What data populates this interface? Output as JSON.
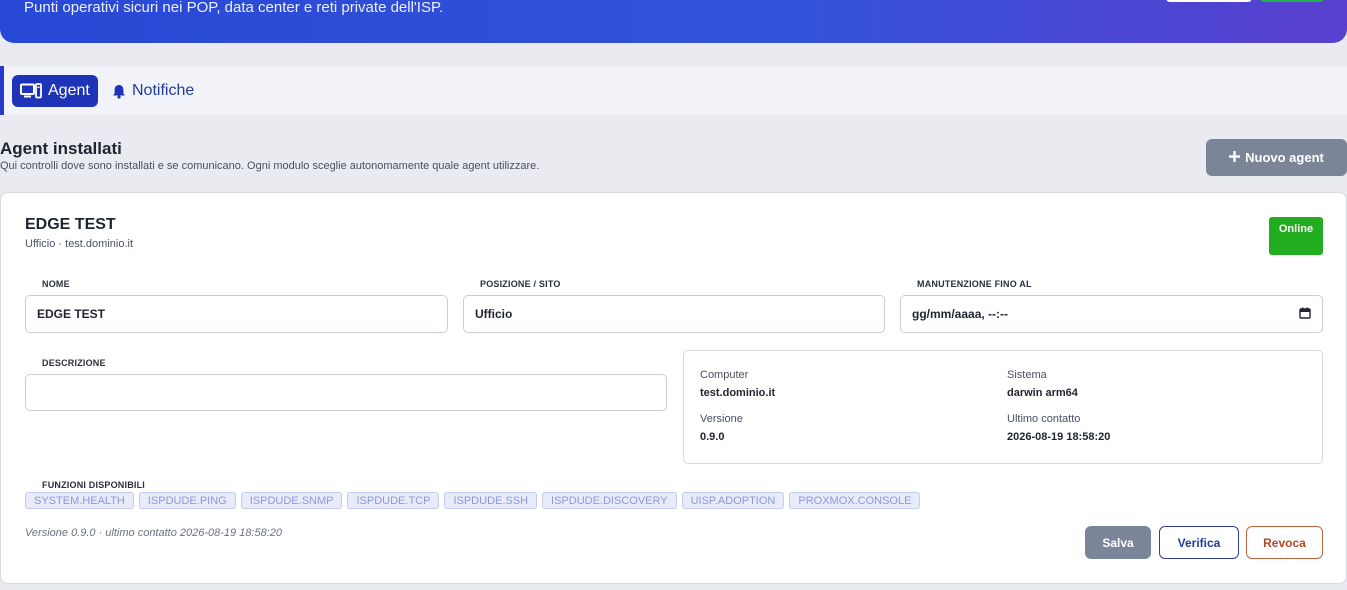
{
  "hero": {
    "subtitle": "Punti operativi sicuri nei POP, data center e reti private dell'ISP."
  },
  "tabs": [
    {
      "label": "Agent",
      "icon": "monitor-icon",
      "active": true
    },
    {
      "label": "Notifiche",
      "icon": "bell-icon",
      "active": false
    }
  ],
  "section": {
    "title": "Agent installati",
    "description": "Qui controlli dove sono installati e se comunicano. Ogni modulo sceglie autonomamente quale agent utilizzare.",
    "new_button": "Nuovo agent"
  },
  "agent": {
    "title": "EDGE TEST",
    "subtitle": "Ufficio · test.dominio.it",
    "status": "Online",
    "fields": {
      "nome_label": "NOME",
      "nome_value": "EDGE TEST",
      "posizione_label": "POSIZIONE / SITO",
      "posizione_value": "Ufficio",
      "manutenzione_label": "MANUTENZIONE FINO AL",
      "manutenzione_placeholder": "gg/mm/aaaa, --:--",
      "descrizione_label": "DESCRIZIONE",
      "descrizione_value": ""
    },
    "info": {
      "computer_label": "Computer",
      "computer_value": "test.dominio.it",
      "sistema_label": "Sistema",
      "sistema_value": "darwin arm64",
      "versione_label": "Versione",
      "versione_value": "0.9.0",
      "contatto_label": "Ultimo contatto",
      "contatto_value": "2026-08-19 18:58:20"
    },
    "functions_label": "FUNZIONI DISPONIBILI",
    "functions": [
      "SYSTEM.HEALTH",
      "ISPDUDE.PING",
      "ISPDUDE.SNMP",
      "ISPDUDE.TCP",
      "ISPDUDE.SSH",
      "ISPDUDE.DISCOVERY",
      "UISP.ADOPTION",
      "PROXMOX.CONSOLE"
    ],
    "footer": "Versione 0.9.0 · ultimo contatto 2026-08-19 18:58:20",
    "buttons": {
      "salva": "Salva",
      "verifica": "Verifica",
      "revoca": "Revoca"
    }
  },
  "colors": {
    "accent": "#1f33b8",
    "online": "#21ad1f",
    "revoke": "#b04a26"
  }
}
